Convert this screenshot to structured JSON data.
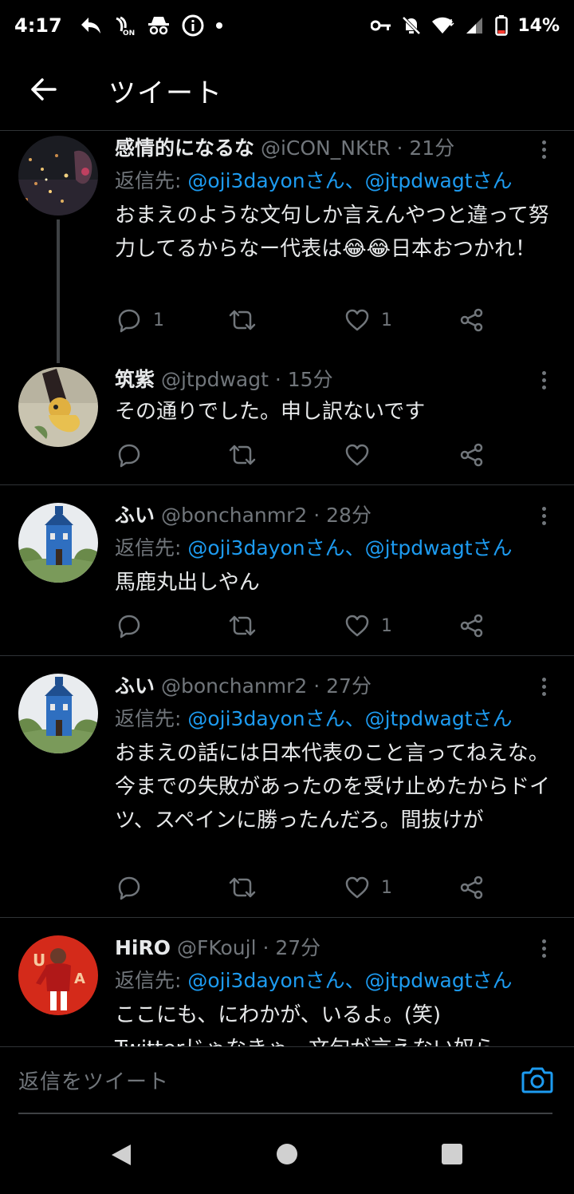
{
  "status_bar": {
    "time": "4:17",
    "battery": "14%",
    "left_icons": [
      "reply-arrow-icon",
      "con-icon",
      "incognito-icon",
      "info-icon",
      "dot-icon"
    ],
    "right_icons": [
      "key-icon",
      "bell-off-icon",
      "wifi-icon",
      "signal-icon",
      "battery-icon"
    ]
  },
  "header": {
    "title": "ツイート",
    "back_icon": "arrow-left-icon"
  },
  "tweets": [
    {
      "name": "感情的になるな",
      "handle": "@iCON_NKtR",
      "sep": "·",
      "time": "21分",
      "reply_prefix": "返信先: ",
      "reply_mentions": [
        "@oji3dayonさん",
        "@jtpdwagtさん"
      ],
      "reply_joiner": "、",
      "text": "おまえのような文句しか言えんやつと違って努力してるからなー代表は😂😂日本おつかれ！",
      "replies": "1",
      "retweets": "",
      "likes": "1"
    },
    {
      "name": "筑紫",
      "handle": "@jtpdwagt",
      "sep": "·",
      "time": "15分",
      "text": "その通りでした。申し訳ないです",
      "replies": "",
      "retweets": "",
      "likes": ""
    },
    {
      "name": "ふい",
      "handle": "@bonchanmr2",
      "sep": "·",
      "time": "28分",
      "reply_prefix": "返信先: ",
      "reply_mentions": [
        "@oji3dayonさん",
        "@jtpdwagtさん"
      ],
      "reply_joiner": "、",
      "text": "馬鹿丸出しやん",
      "replies": "",
      "retweets": "",
      "likes": "1"
    },
    {
      "name": "ふい",
      "handle": "@bonchanmr2",
      "sep": "·",
      "time": "27分",
      "reply_prefix": "返信先: ",
      "reply_mentions": [
        "@oji3dayonさん",
        "@jtpdwagtさん"
      ],
      "reply_joiner": "、",
      "text": "おまえの話には日本代表のこと言ってねえな。今までの失敗があったのを受け止めたからドイツ、スペインに勝ったんだろ。間抜けが",
      "replies": "",
      "retweets": "",
      "likes": "1"
    },
    {
      "name": "HiRO",
      "handle": "@FKoujl",
      "sep": "·",
      "time": "27分",
      "reply_prefix": "返信先: ",
      "reply_mentions": [
        "@oji3dayonさん",
        "@jtpdwagtさん"
      ],
      "reply_joiner": "、",
      "text": "ここにも、にわかが、いるよ。(笑)",
      "text_cut": "Twitterじゃなきゃ、文句が言えない奴ら"
    }
  ],
  "composer": {
    "placeholder": "返信をツイート",
    "camera_icon": "camera-icon"
  },
  "nav": {
    "icons": [
      "back-triangle-icon",
      "home-circle-icon",
      "recents-square-icon"
    ]
  },
  "colors": {
    "background": "#000000",
    "text": "#e7e9ea",
    "muted": "#71767b",
    "accent": "#1d9bf0",
    "divider": "#2f3336"
  }
}
